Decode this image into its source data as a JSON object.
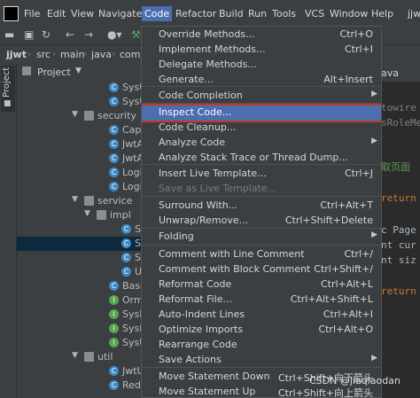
{
  "menubar": {
    "items": [
      "File",
      "Edit",
      "View",
      "Navigate",
      "Code",
      "Refactor",
      "Build",
      "Run",
      "Tools",
      "VCS",
      "Window",
      "Help"
    ],
    "right_text": "jjw"
  },
  "breadcrumb": [
    "jjwt",
    "src",
    "main",
    "java",
    "com"
  ],
  "project_panel": {
    "title": "Project"
  },
  "tree": [
    {
      "label": "SysU",
      "kind": "class"
    },
    {
      "label": "SysU",
      "kind": "class"
    },
    {
      "label": "security",
      "kind": "folder"
    },
    {
      "label": "Capt",
      "kind": "class"
    },
    {
      "label": "JwtA",
      "kind": "class"
    },
    {
      "label": "JwtA",
      "kind": "class"
    },
    {
      "label": "Logi",
      "kind": "class"
    },
    {
      "label": "Logi",
      "kind": "class"
    },
    {
      "label": "service",
      "kind": "folder"
    },
    {
      "label": "impl",
      "kind": "folder"
    },
    {
      "label": "S",
      "kind": "class"
    },
    {
      "label": "S",
      "kind": "class"
    },
    {
      "label": "S",
      "kind": "class"
    },
    {
      "label": "U",
      "kind": "class"
    },
    {
      "label": "Base",
      "kind": "class"
    },
    {
      "label": "Orm",
      "kind": "interface"
    },
    {
      "label": "SysM",
      "kind": "interface"
    },
    {
      "label": "SysR",
      "kind": "interface"
    },
    {
      "label": "SysU",
      "kind": "interface"
    },
    {
      "label": "util",
      "kind": "folder"
    },
    {
      "label": "JwtU",
      "kind": "class"
    },
    {
      "label": "Redi",
      "kind": "class"
    }
  ],
  "editor": {
    "tab": "ava",
    "lines": [
      {
        "text": "towire",
        "color": "#808080"
      },
      {
        "text": "sRoleMe",
        "color": "#808080"
      },
      {
        "text": "取页面",
        "color": "#629755"
      },
      {
        "text": "return",
        "color": "#cc7832"
      },
      {
        "text": "c Page",
        "color": "#a9b7c6"
      },
      {
        "text": "nt cur",
        "color": "#a9b7c6"
      },
      {
        "text": "nt siz",
        "color": "#a9b7c6"
      },
      {
        "text": "return",
        "color": "#cc7832"
      }
    ]
  },
  "code_menu": {
    "items": [
      {
        "label": "Override Methods...",
        "shortcut": "Ctrl+O"
      },
      {
        "label": "Implement Methods...",
        "shortcut": "Ctrl+I"
      },
      {
        "label": "Delegate Methods...",
        "shortcut": ""
      },
      {
        "label": "Generate...",
        "shortcut": "Alt+Insert"
      },
      {
        "label": "Code Completion",
        "shortcut": "",
        "submenu": true
      },
      {
        "label": "Inspect Code...",
        "shortcut": "",
        "highlighted": true
      },
      {
        "label": "Code Cleanup...",
        "shortcut": ""
      },
      {
        "label": "Analyze Code",
        "shortcut": "",
        "submenu": true
      },
      {
        "label": "Analyze Stack Trace or Thread Dump...",
        "shortcut": ""
      },
      {
        "label": "Insert Live Template...",
        "shortcut": "Ctrl+J"
      },
      {
        "label": "Save as Live Template...",
        "shortcut": "",
        "disabled": true
      },
      {
        "label": "Surround With...",
        "shortcut": "Ctrl+Alt+T"
      },
      {
        "label": "Unwrap/Remove...",
        "shortcut": "Ctrl+Shift+Delete"
      },
      {
        "label": "Folding",
        "shortcut": "",
        "submenu": true
      },
      {
        "label": "Comment with Line Comment",
        "shortcut": "Ctrl+/"
      },
      {
        "label": "Comment with Block Comment",
        "shortcut": "Ctrl+Shift+/"
      },
      {
        "label": "Reformat Code",
        "shortcut": "Ctrl+Alt+L"
      },
      {
        "label": "Reformat File...",
        "shortcut": "Ctrl+Alt+Shift+L"
      },
      {
        "label": "Auto-Indent Lines",
        "shortcut": "Ctrl+Alt+I"
      },
      {
        "label": "Optimize Imports",
        "shortcut": "Ctrl+Alt+O"
      },
      {
        "label": "Rearrange Code",
        "shortcut": ""
      },
      {
        "label": "Save Actions",
        "shortcut": "",
        "submenu": true
      },
      {
        "label": "Move Statement Down",
        "shortcut": "Ctrl+Shift+向下箭头"
      },
      {
        "label": "Move Statement Up",
        "shortcut": "Ctrl+Shift+向上箭头"
      }
    ]
  },
  "watermark": "CSDN @jiaqiaodan",
  "colors": {
    "accent": "#4b6eaf",
    "highlight_border": "#c0392b",
    "panel": "#3c3f41",
    "editor_bg": "#2b2b2b"
  }
}
